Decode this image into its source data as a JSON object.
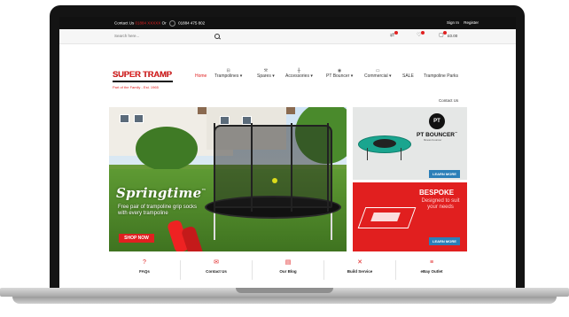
{
  "topbar": {
    "contact_prefix": "Contact Us",
    "contact_link": "01884 XXXXX",
    "or_text": "Or",
    "phone": "01884 475 802",
    "sign_in": "Sign In",
    "register": "Register"
  },
  "search": {
    "placeholder": "Search here..."
  },
  "header": {
    "cart_total": "£0.00"
  },
  "logo": {
    "name": "SUPER TRAMP",
    "tagline": "Part of the Family - Est. 1965"
  },
  "nav": {
    "items": [
      {
        "label": "Home",
        "icon": ""
      },
      {
        "label": "Trampolines",
        "icon": "trampoline-icon"
      },
      {
        "label": "Spares",
        "icon": "wrench-icon"
      },
      {
        "label": "Accessories",
        "icon": "ladder-icon"
      },
      {
        "label": "PT Bouncer",
        "icon": "bouncer-icon"
      },
      {
        "label": "Commercial",
        "icon": "commercial-icon"
      },
      {
        "label": "SALE",
        "icon": ""
      },
      {
        "label": "Trampoline Parks",
        "icon": ""
      }
    ],
    "contact_us": "Contact Us"
  },
  "hero": {
    "title": "Springtime",
    "title_mark": "™",
    "subtitle": "Free pair of trampoline grip socks with every trampoline",
    "cta": "SHOP NOW"
  },
  "promos": {
    "pt": {
      "logo": "PT",
      "name": "PT BOUNCER",
      "name_mark": "™",
      "small": "fitness bouncer",
      "cta": "LEARN MORE"
    },
    "bespoke": {
      "title": "BESPOKE",
      "text": "Designed to suit your needs",
      "cta": "LEARN MORE"
    }
  },
  "bottom_links": [
    {
      "label": "FAQs",
      "icon": "faq-icon"
    },
    {
      "label": "Contact Us",
      "icon": "contact-icon"
    },
    {
      "label": "Our Blog",
      "icon": "blog-icon"
    },
    {
      "label": "Build Service",
      "icon": "tools-icon"
    },
    {
      "label": "eBay Outlet",
      "icon": "ebay-icon"
    }
  ],
  "colors": {
    "brand_red": "#e02020",
    "topbar": "#111111",
    "learn_more_blue": "#2b7fb8"
  }
}
